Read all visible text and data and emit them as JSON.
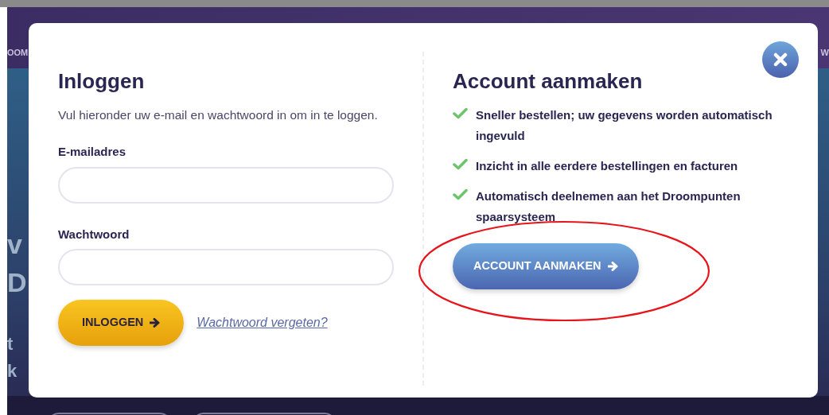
{
  "background": {
    "header_left": "OOM",
    "header_right": "W",
    "hero_fragments": [
      "v",
      "D",
      "t",
      "k"
    ]
  },
  "login": {
    "title": "Inloggen",
    "intro": "Vul hieronder uw e-mail en wachtwoord in om in te loggen.",
    "fields": [
      {
        "label": "E-mailadres"
      },
      {
        "label": "Wachtwoord"
      }
    ],
    "button": "INLOGGEN",
    "forgot_link": "Wachtwoord vergeten?"
  },
  "register": {
    "title": "Account aanmaken",
    "benefits": [
      "Sneller bestellen; uw gegevens worden automatisch ingevuld",
      "Inzicht in alle eerdere bestellingen en facturen",
      "Automatisch deelnemen aan het Droompunten spaarsysteem"
    ],
    "button": "ACCOUNT AANMAKEN"
  }
}
